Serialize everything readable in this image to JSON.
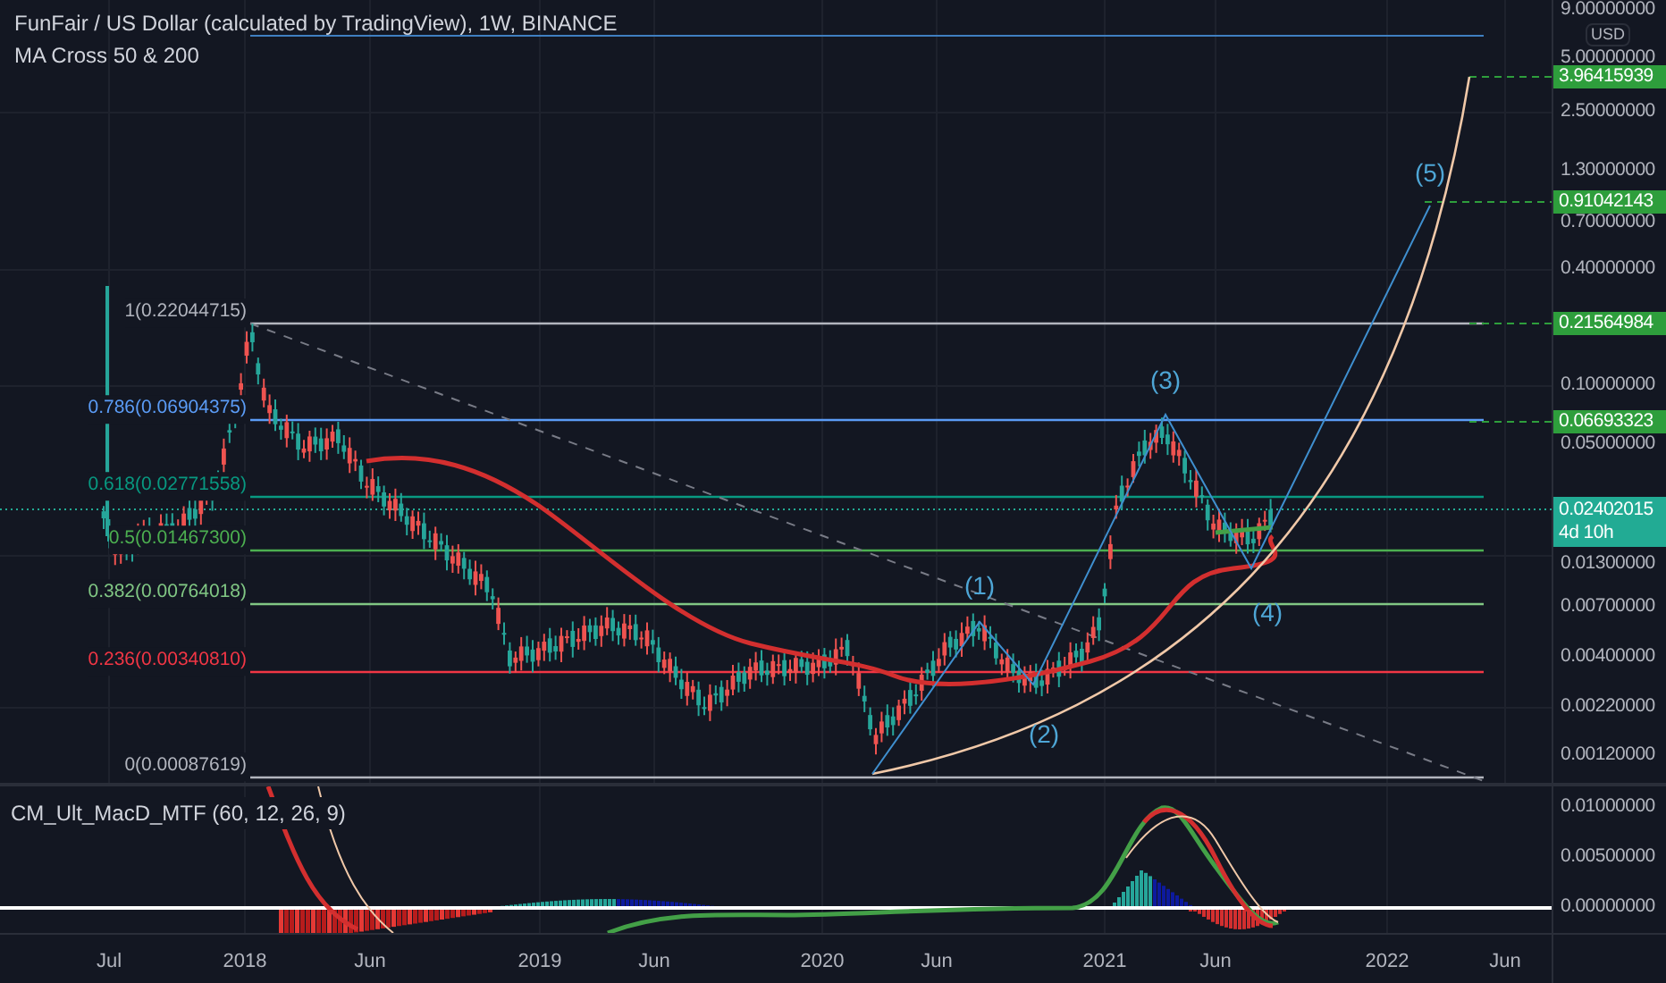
{
  "legend": {
    "title": "FunFair / US Dollar (calculated by TradingView), 1W, BINANCE",
    "indicator": "MA Cross 50 & 200"
  },
  "fib_levels": [
    {
      "label": "1(0.22044715)",
      "color": "#b2b5be"
    },
    {
      "label": "0.786(0.06904375)",
      "color": "#5b9cf6"
    },
    {
      "label": "0.618(0.02771558)",
      "color": "#089981"
    },
    {
      "label": "0.5(0.01467300)",
      "color": "#4caf50"
    },
    {
      "label": "0.382(0.00764018)",
      "color": "#81c784"
    },
    {
      "label": "0.236(0.00340810)",
      "color": "#f23645"
    },
    {
      "label": "0(0.00087619)",
      "color": "#b2b5be"
    }
  ],
  "wave_labels": [
    "(1)",
    "(2)",
    "(3)",
    "(4)",
    "(5)"
  ],
  "price_axis": {
    "currency": "USD",
    "ticks": [
      "9.00000000",
      "5.00000000",
      "2.50000000",
      "1.30000000",
      "0.70000000",
      "0.40000000",
      "0.10000000",
      "0.05000000",
      "0.01300000",
      "0.00700000",
      "0.00400000",
      "0.00220000",
      "0.00120000"
    ],
    "badges": [
      {
        "value": "3.96415939",
        "kind": "target"
      },
      {
        "value": "0.91042143",
        "kind": "target"
      },
      {
        "value": "0.21564984",
        "kind": "target"
      },
      {
        "value": "0.06693323",
        "kind": "target"
      },
      {
        "value": "0.02402015",
        "kind": "last",
        "countdown": "4d 10h"
      }
    ]
  },
  "macd_pane": {
    "title": "CM_Ult_MacD_MTF (60, 12, 26, 9)",
    "ticks": [
      "0.01000000",
      "0.00500000",
      "0.00000000"
    ]
  },
  "time_axis": [
    "Jul",
    "2018",
    "Jun",
    "2019",
    "Jun",
    "2020",
    "Jun",
    "2021",
    "Jun",
    "2022",
    "Jun"
  ]
}
